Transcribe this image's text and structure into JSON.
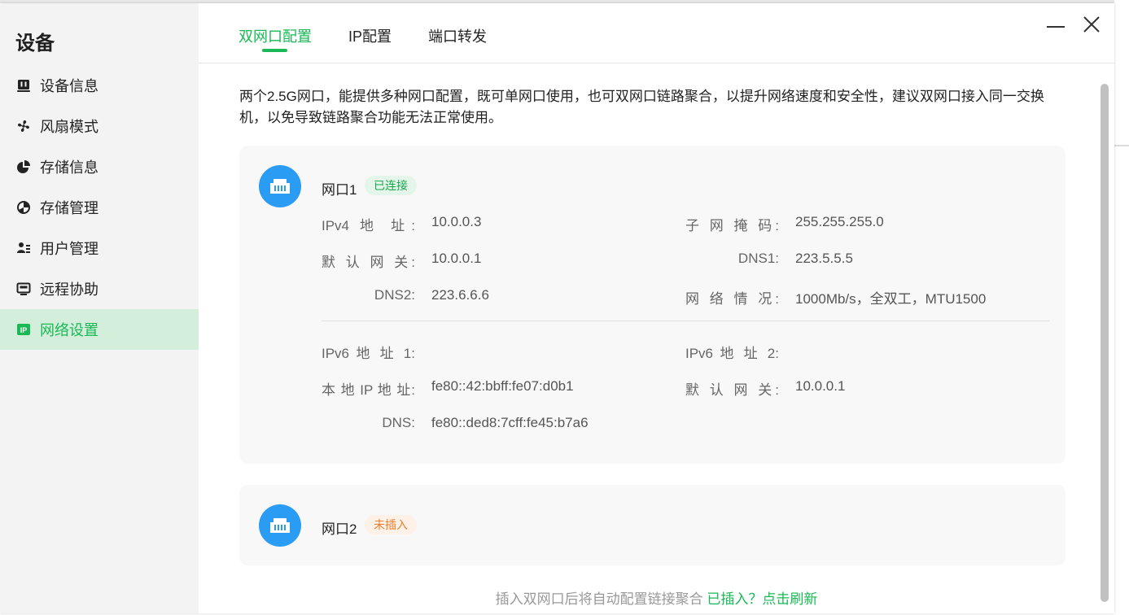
{
  "sidebar": {
    "title": "设备",
    "items": [
      {
        "label": "设备信息",
        "icon": "device-info-icon"
      },
      {
        "label": "风扇模式",
        "icon": "fan-icon"
      },
      {
        "label": "存储信息",
        "icon": "storage-pie-icon"
      },
      {
        "label": "存储管理",
        "icon": "storage-manage-icon"
      },
      {
        "label": "用户管理",
        "icon": "users-icon"
      },
      {
        "label": "远程协助",
        "icon": "monitor-icon"
      },
      {
        "label": "网络设置",
        "icon": "ip-icon"
      }
    ],
    "active_index": 6
  },
  "tabs": [
    {
      "label": "双网口配置",
      "active": true
    },
    {
      "label": "IP配置",
      "active": false
    },
    {
      "label": "端口转发",
      "active": false
    }
  ],
  "description": "两个2.5G网口，能提供多种网口配置，既可单网口使用，也可双网口链路聚合，以提升网络速度和安全性，建议双网口接入同一交换机，以免导致链路聚合功能无法正常使用。",
  "port1": {
    "name": "网口1",
    "status": "已连接",
    "ipv4_label": "IPv4 地 址:",
    "ipv4": "10.0.0.3",
    "mask_label": "子 网 掩 码:",
    "mask": "255.255.255.0",
    "gateway_label": "默 认 网 关:",
    "gateway": "10.0.0.1",
    "dns1_label": "DNS1:",
    "dns1": "223.5.5.5",
    "dns2_label": "DNS2:",
    "dns2": "223.6.6.6",
    "netstat_label": "网 络 情 况:",
    "netstat": "1000Mb/s，全双工，MTU1500",
    "ipv6_1_label": "IPv6 地 址 1:",
    "ipv6_1": "",
    "ipv6_2_label": "IPv6 地 址 2:",
    "ipv6_2": "",
    "local_ip_label": "本 地 IP 地 址:",
    "local_ip": "fe80::42:bbff:fe07:d0b1",
    "gateway6_label": "默 认 网 关:",
    "gateway6": "10.0.0.1",
    "dns6_label": "DNS:",
    "dns6": "fe80::ded8:7cff:fe45:b7a6"
  },
  "port2": {
    "name": "网口2",
    "status": "未插入"
  },
  "footer": {
    "text": "插入双网口后将自动配置链接聚合",
    "link": "已插入？点击刷新"
  },
  "colors": {
    "accent": "#19b955",
    "port_icon": "#2b9cf3",
    "status_ok": "#19a64b",
    "status_warn": "#f07e2c"
  }
}
